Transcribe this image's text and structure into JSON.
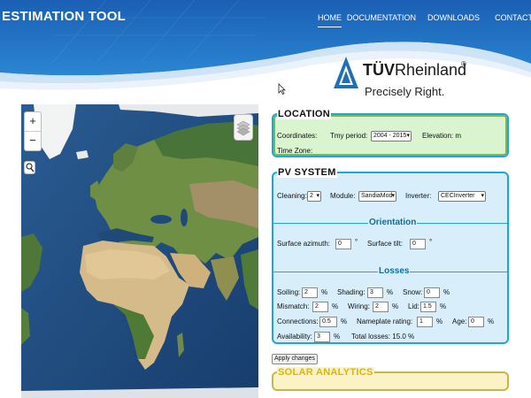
{
  "header": {
    "brand": "ESTIMATION TOOL",
    "nav": [
      {
        "label": "HOME",
        "active": true
      },
      {
        "label": "DOCUMENTATION",
        "active": false
      },
      {
        "label": "DOWNLOADS",
        "active": false
      },
      {
        "label": "CONTACT",
        "active": false
      }
    ],
    "colors": {
      "header_blue": "#1c64b8",
      "wave_light": "#dcebf8"
    }
  },
  "logo": {
    "brand_bold": "TÜV",
    "brand_rest": "Rheinland",
    "registered": "®",
    "tagline": "Precisely Right.",
    "icon": "tuv-triangle-logo-icon"
  },
  "map": {
    "zoom_in": "+",
    "zoom_out": "−",
    "search_icon": "search-icon",
    "layers_icon": "layers-icon"
  },
  "location": {
    "title": "LOCATION",
    "coordinates_label": "Coordinates:",
    "tmy_label": "Tmy period:",
    "tmy_value": "2004 - 2015",
    "elevation_label": "Elevation: m",
    "timezone_label": "Time Zone:"
  },
  "pv": {
    "title": "PV SYSTEM",
    "cleaning_label": "Cleaning:",
    "cleaning_value": "2",
    "module_label": "Module:",
    "module_value": "SandiaMod",
    "inverter_label": "Inverter:",
    "inverter_value": "CECInverter",
    "orientation_title": "Orientation",
    "azimuth_label": "Surface azimuth:",
    "azimuth_value": "0",
    "tilt_label": "Surface tilt:",
    "tilt_value": "0",
    "degree": "°",
    "losses_title": "Losses",
    "percent": "%",
    "losses": {
      "soiling_label": "Soiling:",
      "soiling": "2",
      "shading_label": "Shading:",
      "shading": "3",
      "snow_label": "Snow:",
      "snow": "0",
      "mismatch_label": "Mismatch:",
      "mismatch": "2",
      "wiring_label": "Wiring:",
      "wiring": "2",
      "lid_label": "Lid:",
      "lid": "1.5",
      "connections_label": "Connections:",
      "connections": "0.5",
      "nameplate_label": "Nameplate rating:",
      "nameplate": "1",
      "age_label": "Age:",
      "age": "0",
      "availability_label": "Availability:",
      "availability": "3",
      "total_label": "Total losses: 15.0 %"
    }
  },
  "apply_label": "Apply changes",
  "solar": {
    "title": "SOLAR ANALYTICS"
  }
}
